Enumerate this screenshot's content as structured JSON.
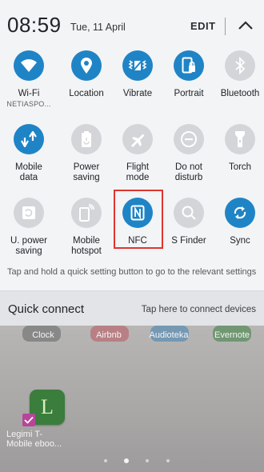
{
  "header": {
    "time": "08:59",
    "date": "Tue, 11 April",
    "edit_label": "EDIT",
    "collapse_icon": "chevron-up-icon"
  },
  "tiles": {
    "wifi": {
      "label": "Wi-Fi",
      "sub": "NETIASPO...",
      "icon": "wifi-icon",
      "state": "on"
    },
    "location": {
      "label": "Location",
      "icon": "location-icon",
      "state": "on"
    },
    "vibrate": {
      "label": "Vibrate",
      "icon": "vibrate-icon",
      "state": "on"
    },
    "portrait": {
      "label": "Portrait",
      "icon": "portrait-lock-icon",
      "state": "on"
    },
    "bluetooth": {
      "label": "Bluetooth",
      "icon": "bluetooth-icon",
      "state": "off"
    },
    "mobile_data": {
      "label_line1": "Mobile",
      "label_line2": "data",
      "icon": "mobile-data-icon",
      "state": "on"
    },
    "power_saving": {
      "label_line1": "Power",
      "label_line2": "saving",
      "icon": "battery-icon",
      "state": "off"
    },
    "flight_mode": {
      "label_line1": "Flight",
      "label_line2": "mode",
      "icon": "airplane-icon",
      "state": "off"
    },
    "do_not_disturb": {
      "label_line1": "Do not",
      "label_line2": "disturb",
      "icon": "do-not-disturb-icon",
      "state": "off"
    },
    "torch": {
      "label": "Torch",
      "icon": "torch-icon",
      "state": "off"
    },
    "u_power_saving": {
      "label_line1": "U. power",
      "label_line2": "saving",
      "icon": "ultra-power-saving-icon",
      "state": "off"
    },
    "mobile_hotspot": {
      "label_line1": "Mobile",
      "label_line2": "hotspot",
      "icon": "hotspot-icon",
      "state": "off"
    },
    "nfc": {
      "label": "NFC",
      "icon": "nfc-icon",
      "state": "on",
      "highlighted": true
    },
    "s_finder": {
      "label": "S Finder",
      "icon": "search-icon",
      "state": "off"
    },
    "sync": {
      "label": "Sync",
      "icon": "sync-icon",
      "state": "on"
    }
  },
  "hint_text": "Tap and hold a quick setting button to go to the relevant settings",
  "quick_connect": {
    "title": "Quick connect",
    "hint": "Tap here to connect devices"
  },
  "home": {
    "apps_row1": [
      "Clock",
      "Airbnb",
      "Audioteka",
      "Evernote"
    ],
    "app_legimi_line1": "Legimi T-",
    "app_legimi_line2": "Mobile eboo...",
    "page_count": 5,
    "current_page": 2
  },
  "colors": {
    "active_tile": "#1f84c6",
    "inactive_tile": "#d3d5d8",
    "highlight_box": "#e0342f"
  }
}
